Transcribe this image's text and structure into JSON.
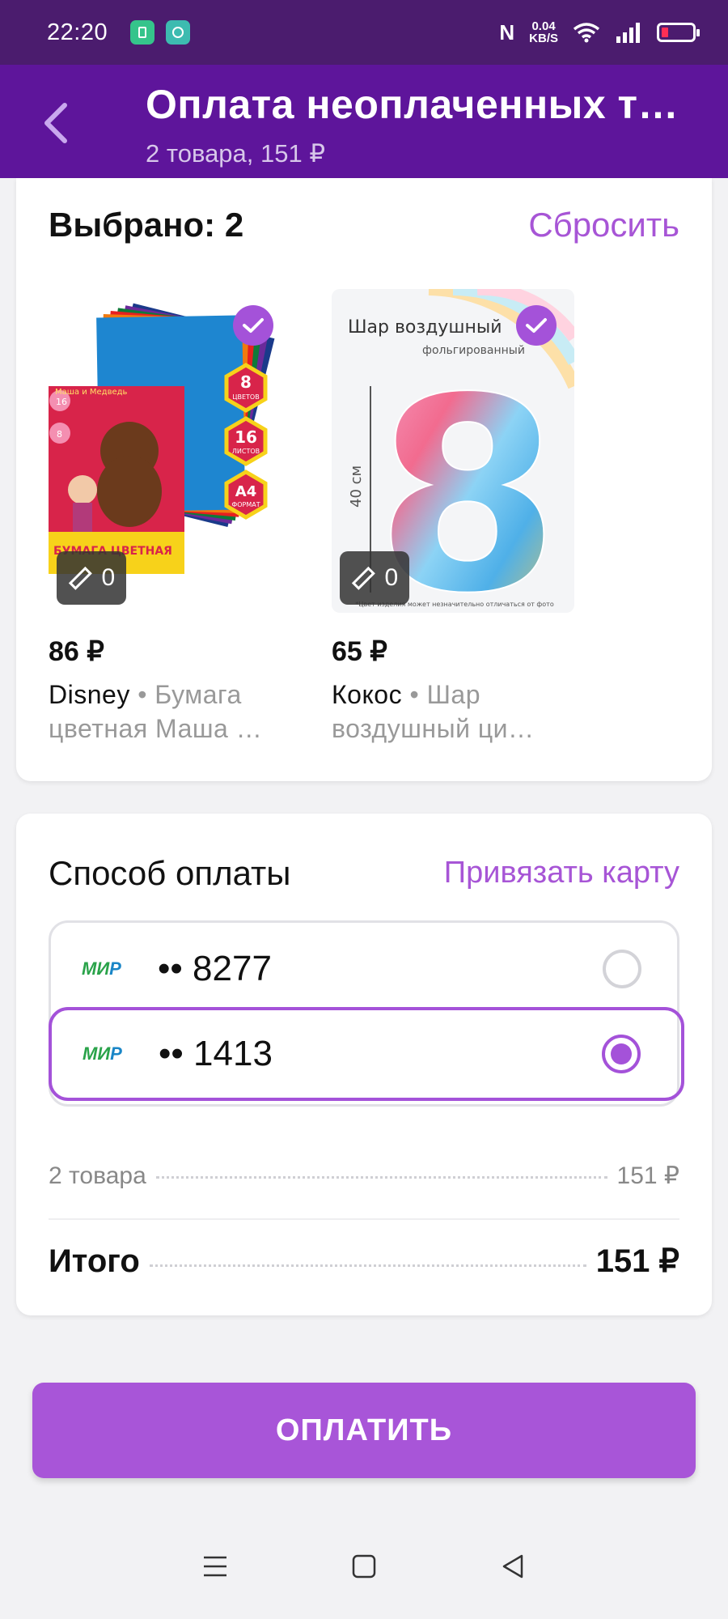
{
  "status_bar": {
    "time": "22:20",
    "speed_value": "0.04",
    "speed_unit": "KB/S",
    "nfc": "N"
  },
  "header": {
    "title": "Оплата неоплаченных т…",
    "subtitle": "2 товара, 151 ₽"
  },
  "selection": {
    "label": "Выбрано: 2",
    "reset": "Сбросить"
  },
  "products": [
    {
      "price": "86 ₽",
      "brand": "Disney",
      "name": "Бумага цветная Маша …",
      "measure_count": "0",
      "selected": true,
      "image_text": {
        "top": "Маша и Медведь",
        "badge1": "16",
        "badge2": "8",
        "h1": "8",
        "h1s": "ЦВЕТОВ",
        "h2": "16",
        "h2s": "ЛИСТОВ",
        "h3": "А4",
        "h3s": "ФОРМАТ",
        "bottom": "БУМАГА ЦВЕТНАЯ"
      }
    },
    {
      "price": "65 ₽",
      "brand": "Кокос",
      "name": "Шар воздушный ци…",
      "measure_count": "0",
      "selected": true,
      "image_text": {
        "title": "Шар воздушный",
        "subtitle": "фольгированный",
        "size": "40 см",
        "digit": "8",
        "note": "*Цвет изделия может незначительно отличаться от фото"
      }
    }
  ],
  "payment": {
    "title": "Способ оплаты",
    "link_card": "Привязать карту",
    "methods": [
      {
        "brand_a": "МИ",
        "brand_b": "Р",
        "masked": "•• 8277",
        "selected": false
      },
      {
        "brand_a": "МИ",
        "brand_b": "Р",
        "masked": "•• 1413",
        "selected": true
      }
    ],
    "items_label": "2 товара",
    "items_amount": "151 ₽",
    "total_label": "Итого",
    "total_amount": "151 ₽"
  },
  "pay_button": "ОПЛАТИТЬ",
  "colors": {
    "header": "#5e159b",
    "statusbar": "#4b1c6e",
    "accent": "#a452d9",
    "button": "#a855d8"
  },
  "icons": [
    "back-arrow-icon",
    "check-icon",
    "ruler-icon",
    "radio-icon",
    "menu-icon",
    "home-icon",
    "back-icon"
  ]
}
